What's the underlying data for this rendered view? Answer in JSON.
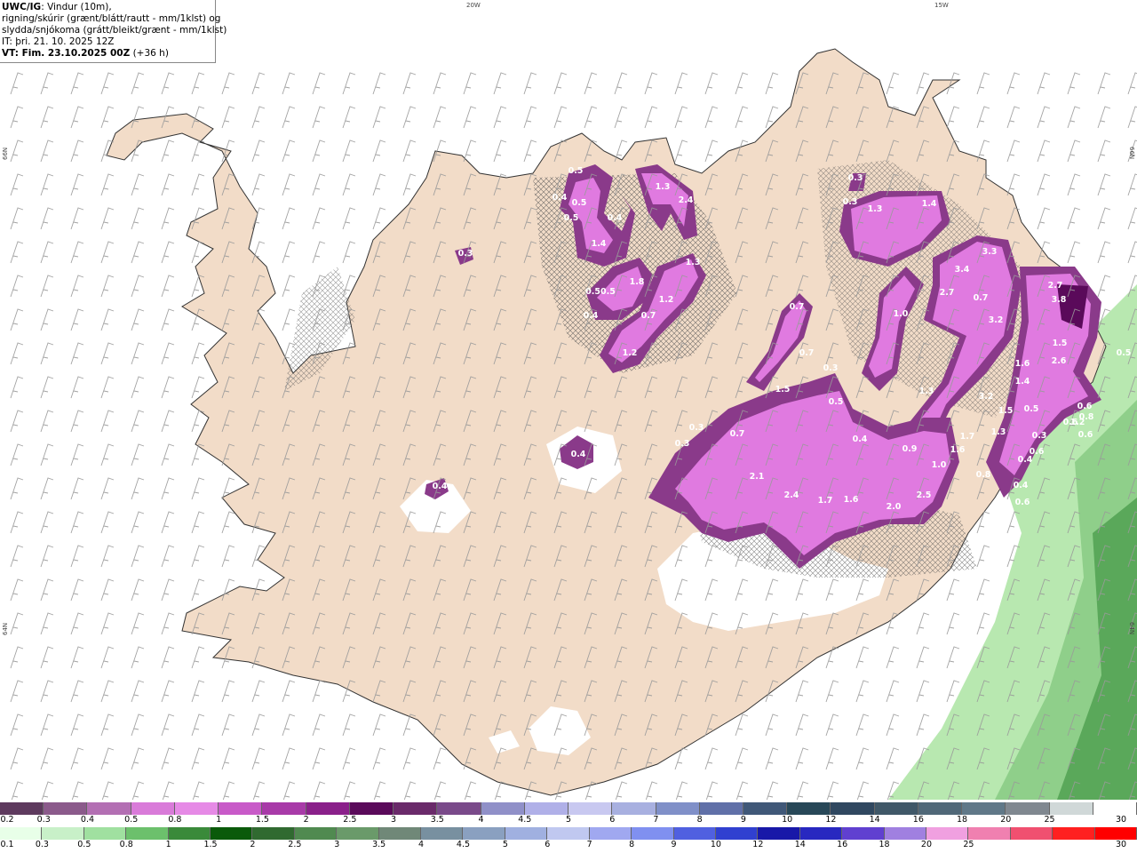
{
  "header": {
    "model": "UWC/IG",
    "line1": ": Vindur (10m),",
    "line2": "rigning/skúrir (grænt/blátt/rautt - mm/1klst) og",
    "line3": "slydda/snjókoma (grátt/bleikt/grænt - mm/1klst)",
    "init": "IT: þri. 21. 10. 2025 12Z",
    "valid": "VT: Fim. 23.10.2025 00Z",
    "lead": "(+36 h)"
  },
  "grid_labels": {
    "lon1": "20W",
    "lon2": "15W",
    "lat1_left": "66N",
    "lat1_right": "66N",
    "lat2_left": "64N",
    "lat2_right": "64N"
  },
  "map_values": [
    {
      "text": "0.5"
    },
    {
      "text": "0.4"
    },
    {
      "text": "0.5"
    },
    {
      "text": "0.5"
    },
    {
      "text": "0.4"
    },
    {
      "text": "1.4"
    },
    {
      "text": "1.3"
    },
    {
      "text": "2.4"
    },
    {
      "text": "0.3"
    },
    {
      "text": "1.8"
    },
    {
      "text": "0.50.5"
    },
    {
      "text": "1.2"
    },
    {
      "text": "0.4"
    },
    {
      "text": "1.3"
    },
    {
      "text": "0.7"
    },
    {
      "text": "1.2"
    },
    {
      "text": "0.3"
    },
    {
      "text": "0.3"
    },
    {
      "text": "1.3"
    },
    {
      "text": "1.4"
    },
    {
      "text": "3.3"
    },
    {
      "text": "3.4"
    },
    {
      "text": "2.7"
    },
    {
      "text": "0.7"
    },
    {
      "text": "1.0"
    },
    {
      "text": "0.7"
    },
    {
      "text": "3.2"
    },
    {
      "text": "2.7"
    },
    {
      "text": "3.8"
    },
    {
      "text": "1.5"
    },
    {
      "text": "2.6"
    },
    {
      "text": "0.5"
    },
    {
      "text": "1.6"
    },
    {
      "text": "0.6"
    },
    {
      "text": "1.4"
    },
    {
      "text": "1.3"
    },
    {
      "text": "3.2"
    },
    {
      "text": "1.5"
    },
    {
      "text": "0.5"
    },
    {
      "text": "0.6"
    },
    {
      "text": "1.2"
    },
    {
      "text": "0.8"
    },
    {
      "text": "0.6"
    },
    {
      "text": "0.3"
    },
    {
      "text": "0.5"
    },
    {
      "text": "1.5"
    },
    {
      "text": "0.3"
    },
    {
      "text": "0.7"
    },
    {
      "text": "0.3"
    },
    {
      "text": "0.4"
    },
    {
      "text": "0.4"
    },
    {
      "text": "0.4"
    },
    {
      "text": "0.9"
    },
    {
      "text": "1.6"
    },
    {
      "text": "1.7"
    },
    {
      "text": "1.3"
    },
    {
      "text": "1.0"
    },
    {
      "text": "0.8"
    },
    {
      "text": "2.1"
    },
    {
      "text": "2.4"
    },
    {
      "text": "1.7"
    },
    {
      "text": "1.6"
    },
    {
      "text": "2.0"
    },
    {
      "text": "2.5"
    },
    {
      "text": "0.4"
    },
    {
      "text": "0.4"
    },
    {
      "text": "0.3"
    },
    {
      "text": "0.7"
    },
    {
      "text": "0.6"
    },
    {
      "text": "0.6"
    }
  ],
  "scale_snow": {
    "colors": [
      "#5e3a5e",
      "#8b5a8b",
      "#b36fb3",
      "#d97bd9",
      "#e68ae6",
      "#c85ac8",
      "#a83aa8",
      "#8a208a",
      "#5a0a5a",
      "#6a2a6a",
      "#7a4a8a",
      "#9090c8",
      "#b0b0e8",
      "#c8c8f0",
      "#a8b0e0",
      "#8090c8",
      "#6070a8",
      "#405878",
      "#284858",
      "#304860",
      "#405868",
      "#506878",
      "#607888",
      "#808890",
      "#d0d8d8",
      "#ffffff"
    ],
    "ticks": [
      "0.2",
      "0.3",
      "0.4",
      "0.5",
      "0.8",
      "1",
      "1.5",
      "2",
      "2.5",
      "3",
      "3.5",
      "4",
      "4.5",
      "5",
      "6",
      "7",
      "8",
      "9",
      "10",
      "12",
      "14",
      "16",
      "18",
      "20",
      "25",
      "30"
    ]
  },
  "scale_rain": {
    "colors": [
      "#e8ffe8",
      "#c8f0c8",
      "#a0e0a0",
      "#6cc06c",
      "#3a8a3a",
      "#0a5a0a",
      "#306a30",
      "#508a50",
      "#6a9a6a",
      "#708878",
      "#7890a0",
      "#8aa0c0",
      "#a0b0e0",
      "#c0c8f0",
      "#a0a8f0",
      "#8090f0",
      "#5060e0",
      "#3040d0",
      "#1818a8",
      "#2828c0",
      "#6040d0",
      "#a080e0",
      "#f0a0e0",
      "#f080b0",
      "#f05070",
      "#ff2020",
      "#ff0000"
    ],
    "ticks": [
      "0.1",
      "0.3",
      "0.5",
      "0.8",
      "1",
      "1.5",
      "2",
      "2.5",
      "3",
      "3.5",
      "4",
      "4.5",
      "5",
      "6",
      "7",
      "8",
      "9",
      "10",
      "12",
      "14",
      "16",
      "18",
      "20",
      "25",
      "30"
    ]
  }
}
